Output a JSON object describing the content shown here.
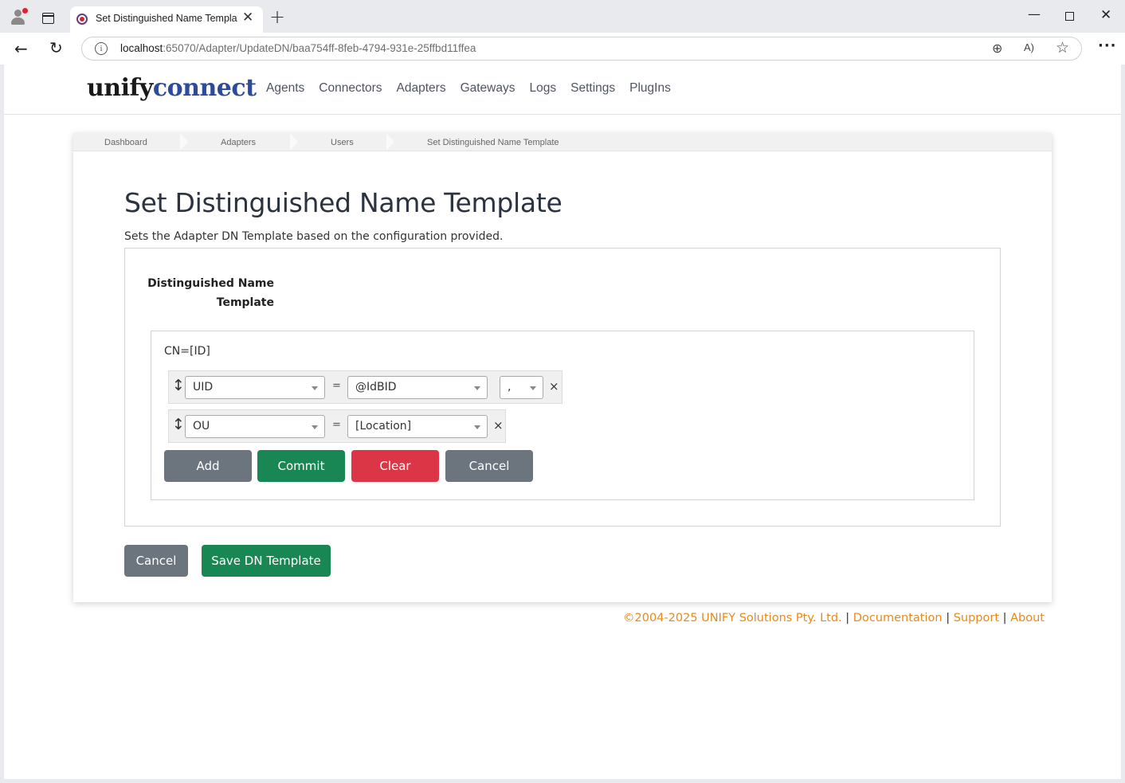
{
  "browser": {
    "tab_title": "Set Distinguished Name Template",
    "tab_close": "✕",
    "new_tab": "+",
    "url_host": "localhost",
    "url_rest": ":65070/Adapter/UpdateDN/baa754ff-8feb-4794-931e-25ffbd11ffea",
    "win_min": "—",
    "win_close": "✕"
  },
  "brand": {
    "part1": "unify",
    "part2": "connect"
  },
  "nav": [
    "Agents",
    "Connectors",
    "Adapters",
    "Gateways",
    "Logs",
    "Settings",
    "PlugIns"
  ],
  "breadcrumb": [
    "Dashboard",
    "Adapters",
    "Users",
    "Set Distinguished Name Template"
  ],
  "page": {
    "title": "Set Distinguished Name Template",
    "description": "Sets the Adapter DN Template based on the configuration provided.",
    "field_label_line1": "Distinguished Name",
    "field_label_line2": "Template"
  },
  "dn_builder": {
    "preview": "CN=[ID]",
    "rows": [
      {
        "attribute": "UID",
        "equals": "=",
        "value": "@IdBID",
        "separator": ",",
        "remove": "×"
      },
      {
        "attribute": "OU",
        "equals": "=",
        "value": "[Location]",
        "remove": "×"
      }
    ],
    "buttons": {
      "add": "Add",
      "commit": "Commit",
      "clear": "Clear",
      "cancel": "Cancel"
    }
  },
  "actions": {
    "cancel": "Cancel",
    "save": "Save DN Template"
  },
  "footer": {
    "copyright": "©2004-2025 UNIFY Solutions Pty. Ltd.",
    "sep": "|",
    "documentation": "Documentation",
    "support": "Support",
    "about": "About"
  },
  "colors": {
    "secondary": "#6c757d",
    "success": "#198754",
    "danger": "#dc3545",
    "link": "#e8891d",
    "brand_blue": "#2d4b9a"
  }
}
